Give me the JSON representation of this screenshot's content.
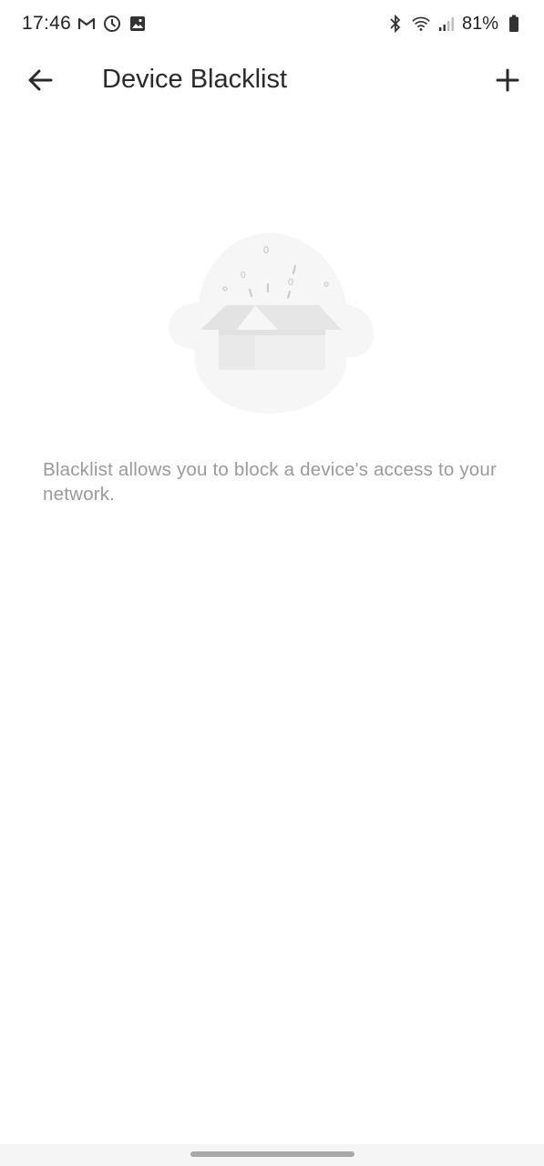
{
  "status_bar": {
    "time": "17:46",
    "battery": "81%",
    "left_icons": [
      "gmail-icon",
      "clock-icon",
      "gallery-icon"
    ],
    "right_icons": [
      "bluetooth-icon",
      "wifi-icon",
      "signal-icon",
      "battery-icon"
    ]
  },
  "app_bar": {
    "title": "Device Blacklist",
    "back_icon": "arrow-left-icon",
    "add_icon": "plus-icon"
  },
  "empty_state": {
    "illustration": "open-box-icon",
    "message": "Blacklist allows you to block a device's access to your network."
  },
  "colors": {
    "text_primary": "#2a2a2a",
    "text_secondary": "#9a9a9a",
    "background": "#ffffff"
  }
}
